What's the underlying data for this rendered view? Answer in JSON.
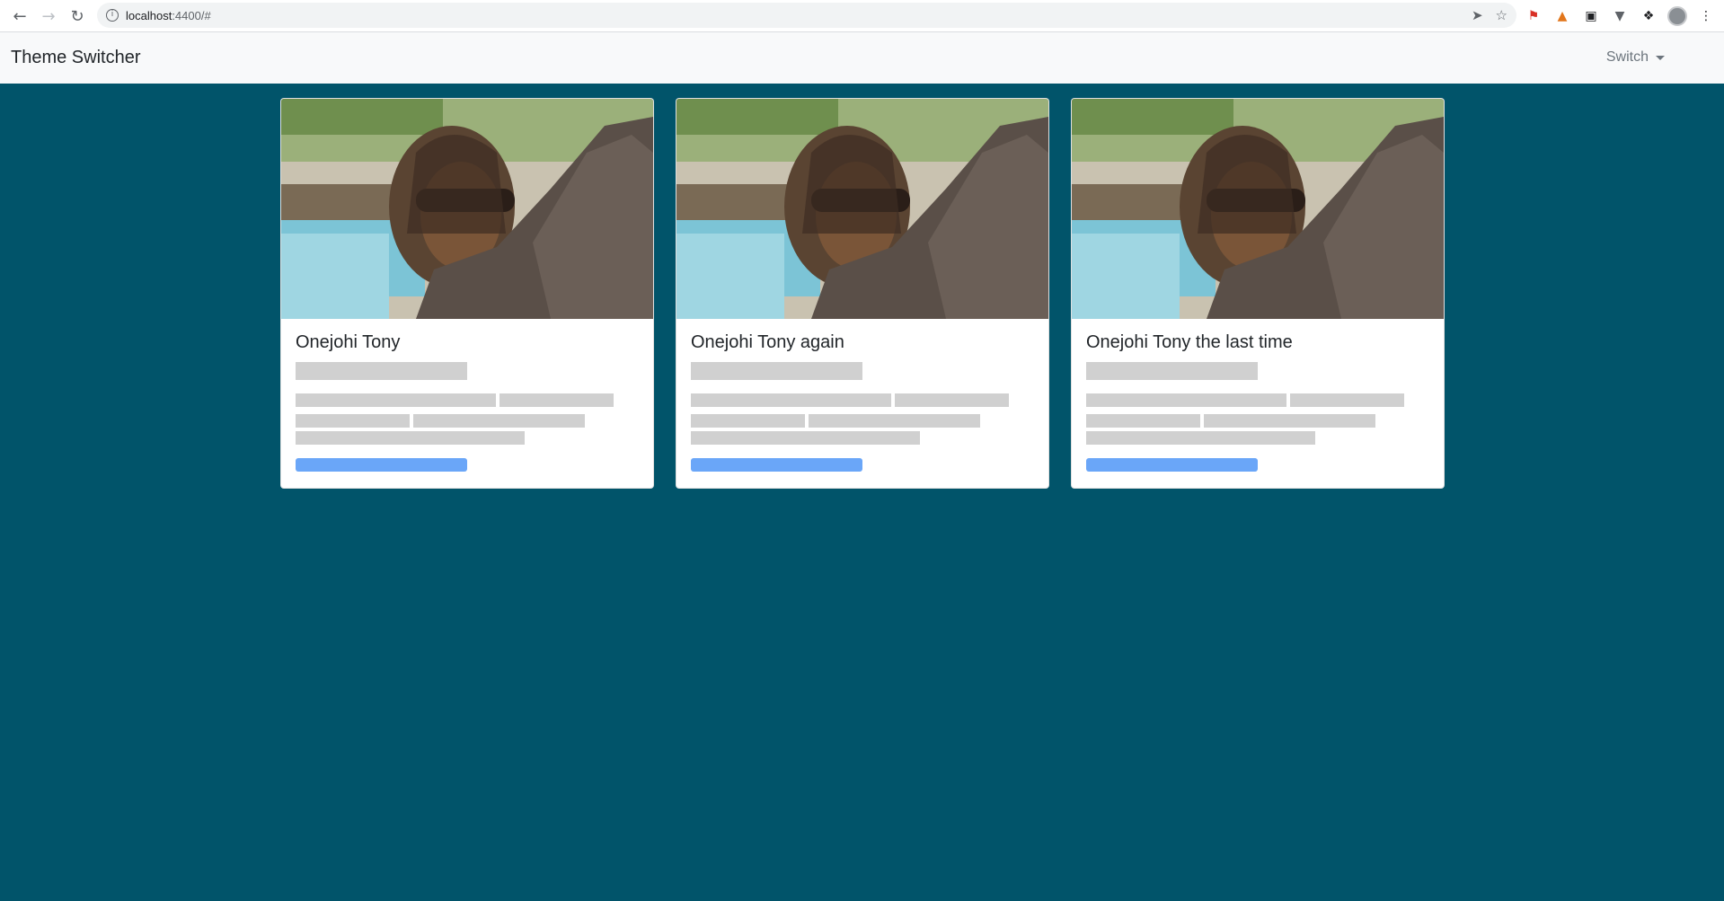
{
  "browser": {
    "url_host": "localhost",
    "url_rest": ":4400/#",
    "back_icon": "arrow-left-icon",
    "forward_icon": "arrow-right-icon",
    "reload_icon": "reload-icon"
  },
  "navbar": {
    "brand": "Theme Switcher",
    "switch_label": "Switch"
  },
  "cards": [
    {
      "title": "Onejohi Tony"
    },
    {
      "title": "Onejohi Tony again"
    },
    {
      "title": "Onejohi Tony the last time"
    }
  ],
  "colors": {
    "page_background": "#01546a",
    "card_background": "#ffffff",
    "placeholder": "#d0d0d0",
    "button_placeholder": "#6aa6f8",
    "navbar_background": "#f8f9fa"
  }
}
